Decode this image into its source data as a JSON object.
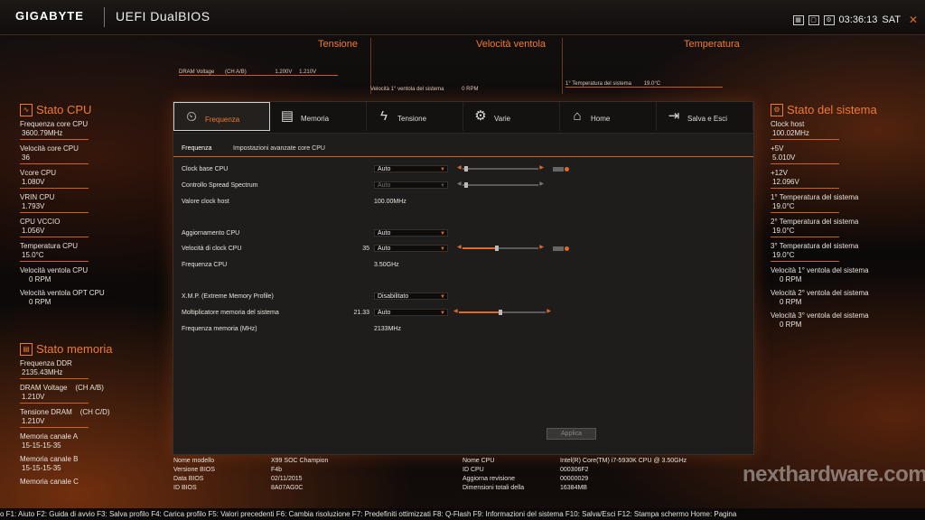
{
  "header": {
    "brand": "GIGABYTE",
    "title": "UEFI DualBIOS",
    "time": "03:36:13",
    "day": "SAT"
  },
  "monitor": {
    "voltage": {
      "title": "Tensione",
      "label": "DRAM Voltage",
      "channel": "(CH A/B)",
      "v1": "1.200V",
      "v2": "1.210V"
    },
    "fan": {
      "title": "Velocità ventola",
      "label": "Velocità 1° ventola del sistema",
      "value": "0 RPM"
    },
    "temp": {
      "title": "Temperatura",
      "label": "1° Temperatura del sistema",
      "value": "19.0°C"
    }
  },
  "cpu_status": {
    "title": "Stato CPU",
    "items": [
      {
        "label": "Frequenza core CPU",
        "value": "3600.79MHz"
      },
      {
        "label": "Velocità core CPU",
        "value": "36"
      },
      {
        "label": "Vcore CPU",
        "value": "1.080V"
      },
      {
        "label": "VRIN CPU",
        "value": "1.793V"
      },
      {
        "label": "CPU VCCIO",
        "value": "1.056V"
      },
      {
        "label": "Temperatura CPU",
        "value": "15.0°C"
      },
      {
        "label": "Velocità ventola CPU",
        "value": "0 RPM"
      },
      {
        "label": "Velocità ventola OPT CPU",
        "value": "0 RPM"
      }
    ]
  },
  "mem_status": {
    "title": "Stato memoria",
    "items": [
      {
        "label": "Frequenza DDR",
        "value": "2135.43MHz"
      },
      {
        "label": "DRAM Voltage    (CH A/B)",
        "value": "1.210V"
      },
      {
        "label": "Tensione DRAM    (CH C/D)",
        "value": "1.210V"
      },
      {
        "label": "Memoria canale A",
        "value": "15-15-15-35"
      },
      {
        "label": "Memoria canale B",
        "value": "15-15-15-35"
      },
      {
        "label": "Memoria canale C",
        "value": ""
      }
    ]
  },
  "sys_status": {
    "title": "Stato del sistema",
    "items": [
      {
        "label": "Clock host",
        "value": "100.02MHz"
      },
      {
        "label": "+5V",
        "value": "5.010V"
      },
      {
        "label": "+12V",
        "value": "12.096V"
      },
      {
        "label": "1° Temperatura del sistema",
        "value": "19.0°C"
      },
      {
        "label": "2° Temperatura del sistema",
        "value": "19.0°C"
      },
      {
        "label": "3° Temperatura del sistema",
        "value": "19.0°C"
      },
      {
        "label": "Velocità 1° ventola del sistema",
        "value": "0 RPM"
      },
      {
        "label": "Velocità 2° ventola del sistema",
        "value": "0 RPM"
      },
      {
        "label": "Velocità 3° ventola del sistema",
        "value": "0 RPM"
      }
    ]
  },
  "nav": [
    {
      "label": "Frequenza",
      "icon": "gauge-icon",
      "glyph": "⏲"
    },
    {
      "label": "Memoria",
      "icon": "memory-icon",
      "glyph": "▤"
    },
    {
      "label": "Tensione",
      "icon": "voltage-icon",
      "glyph": "ϟ"
    },
    {
      "label": "Varie",
      "icon": "gear-icon",
      "glyph": "⚙"
    },
    {
      "label": "Home",
      "icon": "home-icon",
      "glyph": "⌂"
    },
    {
      "label": "Salva e Esci",
      "icon": "exit-icon",
      "glyph": "⇥"
    }
  ],
  "subtabs": [
    "Frequenza",
    "Impostazioni avanzate core CPU"
  ],
  "settings": {
    "clock_base": {
      "label": "Clock base CPU",
      "value": "Auto"
    },
    "spread": {
      "label": "Controllo Spread Spectrum",
      "value": "Auto"
    },
    "clock_host": {
      "label": "Valore clock host",
      "value": "100.00MHz"
    },
    "aggiornamento": {
      "label": "Aggiornamento CPU",
      "value": "Auto"
    },
    "clock_speed": {
      "label": "Velocità di clock CPU",
      "num": "35",
      "value": "Auto"
    },
    "freq_cpu": {
      "label": "Frequenza CPU",
      "value": "3.50GHz"
    },
    "xmp": {
      "label": "X.M.P. (Extreme Memory Profile)",
      "value": "Disabilitato"
    },
    "mem_mult": {
      "label": "Moltiplicatore memoria del sistema",
      "num": "21.33",
      "value": "Auto"
    },
    "mem_freq": {
      "label": "Frequenza memoria (MHz)",
      "value": "2133MHz"
    }
  },
  "apply_label": "Applica",
  "sysinfo": {
    "model_label": "Nome modello",
    "model": "X99 SOC Champion",
    "biosver_label": "Versione BIOS",
    "biosver": "F4b",
    "biosdate_label": "Data BIOS",
    "biosdate": "02/11/2015",
    "biosid_label": "ID BIOS",
    "biosid": "8A07AG0C",
    "cpuname_label": "Nome CPU",
    "cpuname": "Intel(R) Core(TM) i7-5930K CPU @ 3.50GHz",
    "cpuid_label": "ID CPU",
    "cpuid": "000306F2",
    "update_label": "Aggiorna revisione",
    "update": "00000029",
    "memsize_label": "Dimensioni totali della",
    "memsize": "16384MB"
  },
  "footer": "o F1: Aiuto F2: Guida di avvio F3: Salva profilo F4: Carica profilo F5: Valori precedenti F6: Cambia risoluzione F7: Predefiniti ottimizzati F8: Q-Flash F9: Informazioni del sistema F10: Salva/Esci F12: Stampa schermo Home: Pagina",
  "watermark": "nexthardware.com"
}
